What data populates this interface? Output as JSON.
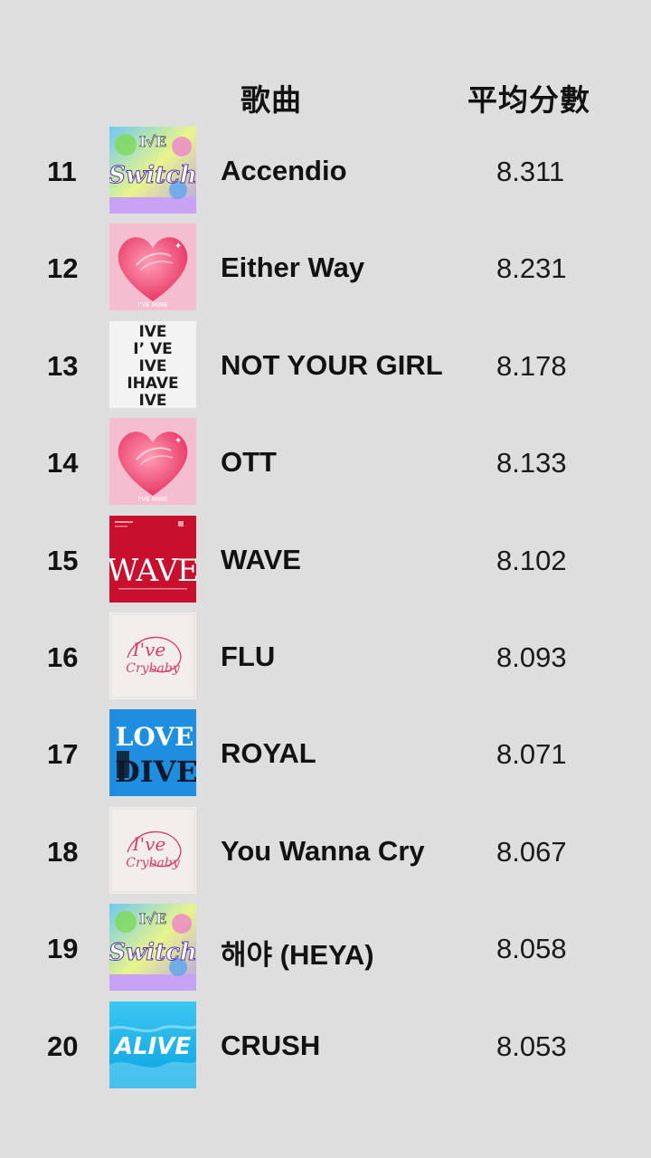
{
  "header": {
    "song": "歌曲",
    "score": "平均分數"
  },
  "rows": [
    {
      "rank": "11",
      "title": "Accendio",
      "score": "8.311",
      "cover": "switch-album-cover"
    },
    {
      "rank": "12",
      "title": "Either Way",
      "score": "8.231",
      "cover": "ive-empathy-heart-cover"
    },
    {
      "rank": "13",
      "title": "NOT YOUR GIRL",
      "score": "8.178",
      "cover": "i-have-ive-cover"
    },
    {
      "rank": "14",
      "title": "OTT",
      "score": "8.133",
      "cover": "ive-empathy-heart-cover"
    },
    {
      "rank": "15",
      "title": "WAVE",
      "score": "8.102",
      "cover": "wave-cover"
    },
    {
      "rank": "16",
      "title": "FLU",
      "score": "8.093",
      "cover": "ive-crybaby-cover"
    },
    {
      "rank": "17",
      "title": "ROYAL",
      "score": "8.071",
      "cover": "love-dive-cover"
    },
    {
      "rank": "18",
      "title": "You Wanna Cry",
      "score": "8.067",
      "cover": "ive-crybaby-cover"
    },
    {
      "rank": "19",
      "title": "해야 (HEYA)",
      "score": "8.058",
      "cover": "switch-album-cover"
    },
    {
      "rank": "20",
      "title": "CRUSH",
      "score": "8.053",
      "cover": "alive-cover"
    }
  ],
  "colors": {
    "background": "#dedede",
    "text": "#121212"
  }
}
